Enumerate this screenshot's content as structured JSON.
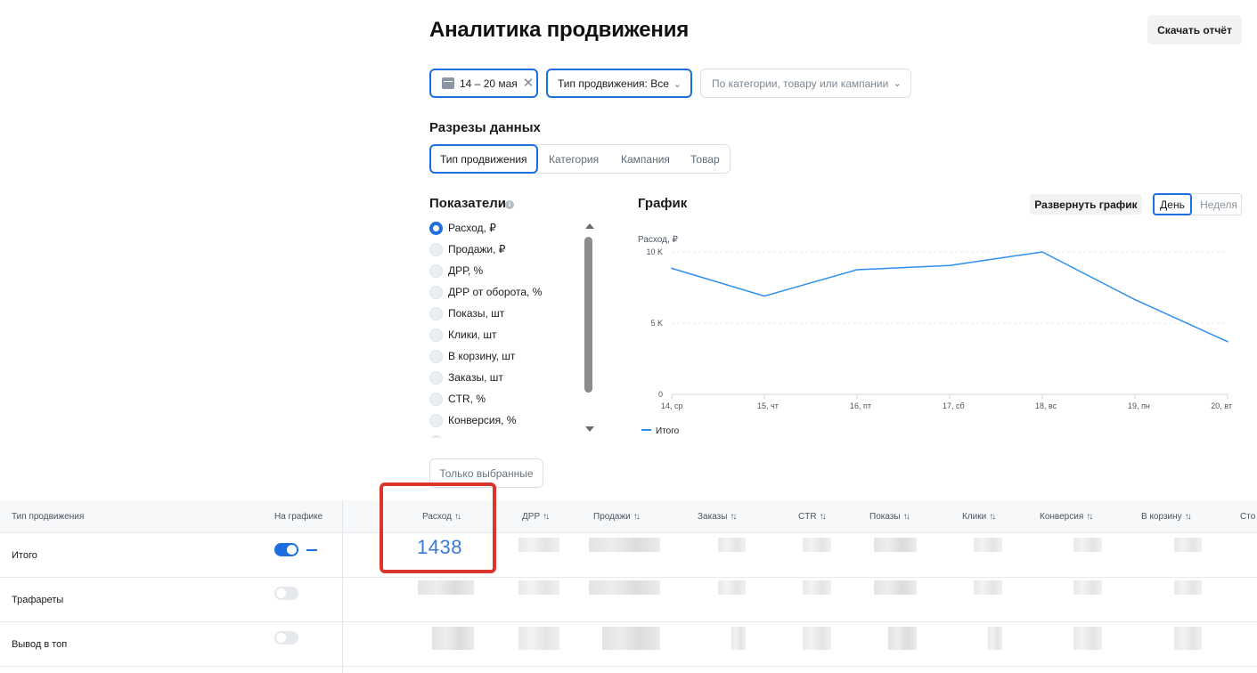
{
  "header": {
    "title": "Аналитика продвижения",
    "download_label": "Скачать отчёт"
  },
  "filters": {
    "date": "14 – 20 мая",
    "promo_type": "Тип продвижения: Все",
    "search_placeholder": "По категории, товару или кампании"
  },
  "slices": {
    "title": "Разрезы данных",
    "tabs": [
      {
        "label": "Тип продвижения",
        "active": true
      },
      {
        "label": "Категория",
        "active": false
      },
      {
        "label": "Кампания",
        "active": false
      },
      {
        "label": "Товар",
        "active": false
      }
    ]
  },
  "indicators": {
    "title": "Показатели",
    "items": [
      {
        "label": "Расход, ₽",
        "selected": true
      },
      {
        "label": "Продажи, ₽",
        "selected": false
      },
      {
        "label": "ДРР, %",
        "selected": false
      },
      {
        "label": "ДРР от оборота, %",
        "selected": false
      },
      {
        "label": "Показы, шт",
        "selected": false
      },
      {
        "label": "Клики, шт",
        "selected": false
      },
      {
        "label": "В корзину, шт",
        "selected": false
      },
      {
        "label": "Заказы, шт",
        "selected": false
      },
      {
        "label": "CTR, %",
        "selected": false
      },
      {
        "label": "Конверсия, %",
        "selected": false
      }
    ],
    "only_selected_label": "Только выбранные"
  },
  "chart_panel": {
    "title": "График",
    "expand_label": "Развернуть график",
    "period_day": "День",
    "period_week": "Неделя"
  },
  "chart_data": {
    "type": "line",
    "ylabel": "Расход, ₽",
    "categories": [
      "14, ср",
      "15, чт",
      "16, пт",
      "17, сб",
      "18, вс",
      "19, пн",
      "20, вт"
    ],
    "yticks": [
      "0",
      "5 K",
      "10 K"
    ],
    "ylim": [
      0,
      10000
    ],
    "grid": true,
    "legend_position": "bottom-left",
    "series": [
      {
        "name": "Итого",
        "color": "#2e8ff0",
        "values": [
          8850,
          6900,
          8750,
          9050,
          10000,
          6650,
          3700
        ]
      }
    ]
  },
  "table": {
    "columns": {
      "type": "Тип продвижения",
      "on_chart": "На графике",
      "spend": "Расход",
      "drr": "ДРР",
      "sales": "Продажи",
      "orders": "Заказы",
      "ctr": "CTR",
      "views": "Показы",
      "clicks": "Клики",
      "conversion": "Конверсия",
      "cart": "В корзину",
      "cost": "Сто"
    },
    "sort_glyph": "↑↓",
    "rows": [
      {
        "label": "Итого",
        "on_chart": true,
        "spend": "1438"
      },
      {
        "label": "Трафареты",
        "on_chart": false
      },
      {
        "label": "Вывод в топ",
        "on_chart": false
      }
    ]
  }
}
